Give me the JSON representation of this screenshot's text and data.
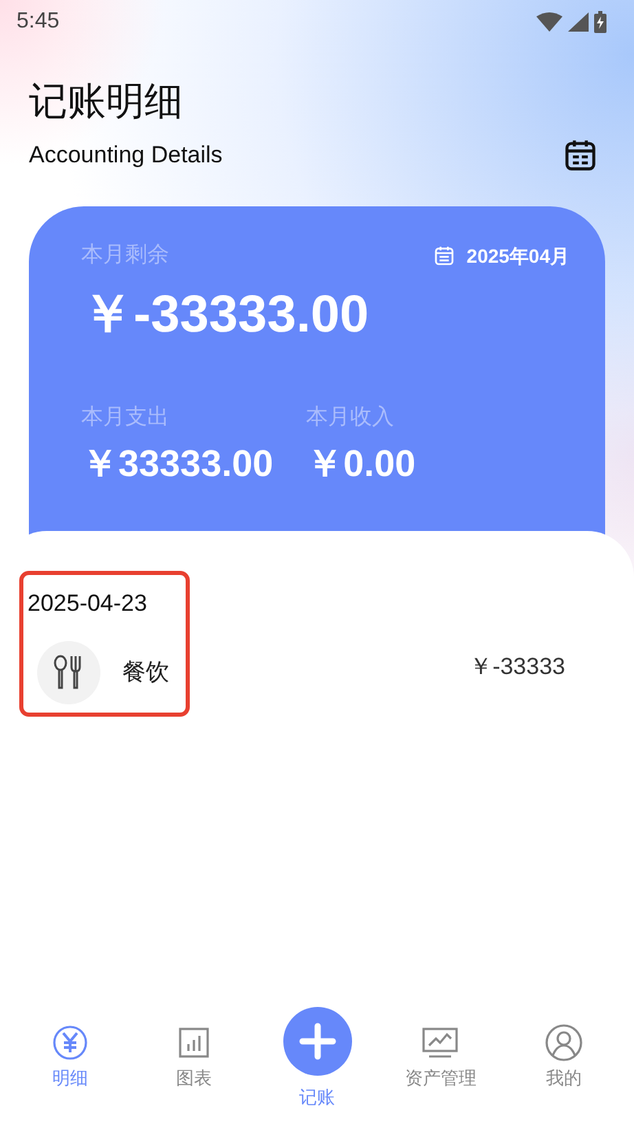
{
  "status_bar": {
    "time": "5:45"
  },
  "header": {
    "title": "记账明细",
    "subtitle": "Accounting Details"
  },
  "summary": {
    "balance_label": "本月剩余",
    "month": "2025年04月",
    "balance": "￥-33333.00",
    "expense_label": "本月支出",
    "expense": "￥33333.00",
    "income_label": "本月收入",
    "income": "￥0.00"
  },
  "records": [
    {
      "date": "2025-04-23",
      "highlighted": true,
      "entries": [
        {
          "category": "餐饮",
          "amount": "￥-33333"
        }
      ]
    }
  ],
  "tab_bar": [
    {
      "label": "明细",
      "kind": "yuan",
      "selected": true
    },
    {
      "label": "图表",
      "kind": "chart",
      "selected": false
    },
    {
      "label": "记账",
      "kind": "add",
      "selected": false
    },
    {
      "label": "资产管理",
      "kind": "monitor",
      "selected": false
    },
    {
      "label": "我的",
      "kind": "user",
      "selected": false
    }
  ]
}
